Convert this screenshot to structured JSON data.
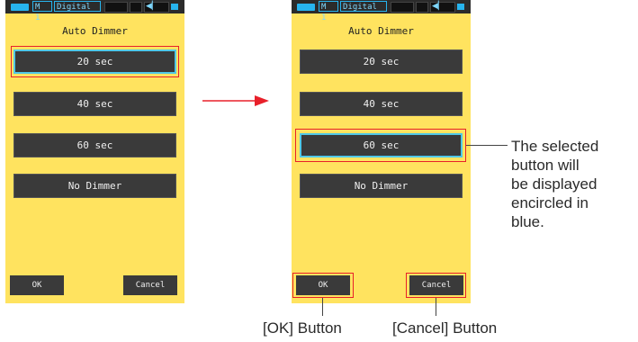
{
  "status_bar": {
    "mode": "M 1",
    "measurement": "Digital",
    "glyph": "◀▏"
  },
  "screens": [
    {
      "title": "Auto Dimmer",
      "options": [
        "20 sec",
        "40 sec",
        "60 sec",
        "No Dimmer"
      ],
      "selected": "20 sec",
      "ok_label": "OK",
      "cancel_label": "Cancel"
    },
    {
      "title": "Auto Dimmer",
      "options": [
        "20 sec",
        "40 sec",
        "60 sec",
        "No Dimmer"
      ],
      "selected": "60 sec",
      "ok_label": "OK",
      "cancel_label": "Cancel"
    }
  ],
  "annotations": {
    "selected_note": "The selected\nbutton will\nbe displayed\nencircled in\nblue.",
    "ok_label": "[OK] Button",
    "cancel_label": "[Cancel] Button"
  },
  "colors": {
    "screen_bg": "#ffe35f",
    "button_bg": "#3a3a3a",
    "selected_border": "#4fc8e8",
    "highlight_box": "#e8202a"
  }
}
